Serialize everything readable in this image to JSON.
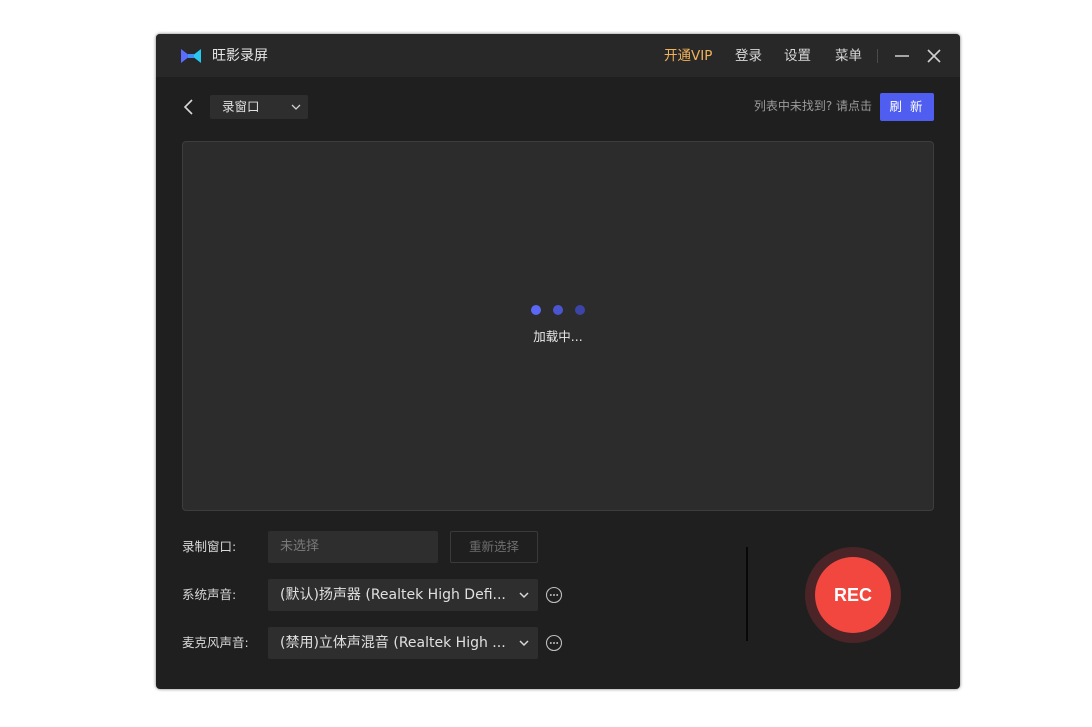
{
  "app": {
    "title": "旺影录屏",
    "logo_colors": [
      "#5b6cff",
      "#28c8f0"
    ]
  },
  "titlebar": {
    "vip_label": "开通VIP",
    "login_label": "登录",
    "settings_label": "设置",
    "menu_label": "菜单",
    "vip_color": "#f0b35a"
  },
  "toolbar": {
    "mode_selected": "录窗口",
    "hint": "列表中未找到? 请点击",
    "refresh_label": "刷 新",
    "refresh_color": "#4f5ef0"
  },
  "preview": {
    "loading_text": "加载中...",
    "dot_colors": [
      "#5b68f5",
      "#4a55d0",
      "#3c44a8"
    ]
  },
  "form": {
    "window_label": "录制窗口:",
    "window_placeholder": "未选择",
    "reselect_label": "重新选择",
    "system_audio_label": "系统声音:",
    "system_audio_value": "(默认)扬声器 (Realtek High Defi...",
    "mic_label": "麦克风声音:",
    "mic_value": "(禁用)立体声混音 (Realtek High ..."
  },
  "record": {
    "label": "REC",
    "color": "#f2473f",
    "ring_color": "#4a2426"
  }
}
